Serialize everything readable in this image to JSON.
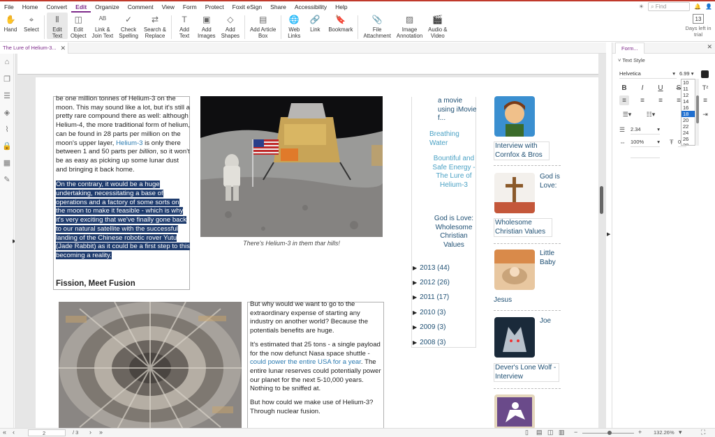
{
  "menu": [
    "File",
    "Home",
    "Convert",
    "Edit",
    "Organize",
    "Comment",
    "View",
    "Form",
    "Protect",
    "Foxit eSign",
    "Share",
    "Accessibility",
    "Help"
  ],
  "menu_active": "Edit",
  "find_placeholder": "Find",
  "ribbon": [
    {
      "label": "Hand",
      "icon": "hand-icon"
    },
    {
      "label": "Select",
      "icon": "select-cursor-icon"
    },
    {
      "label": "Edit\nText",
      "icon": "edit-text-icon",
      "selected": true
    },
    {
      "label": "Edit\nObject",
      "icon": "edit-object-icon"
    },
    {
      "label": "Link &\nJoin Text",
      "icon": "link-join-text-icon"
    },
    {
      "label": "Check\nSpelling",
      "icon": "check-spelling-icon"
    },
    {
      "label": "Search &\nReplace",
      "icon": "search-replace-icon"
    },
    {
      "label": "Add\nText",
      "icon": "add-text-icon"
    },
    {
      "label": "Add\nImages",
      "icon": "add-images-icon"
    },
    {
      "label": "Add\nShapes",
      "icon": "add-shapes-icon"
    },
    {
      "label": "Add Article\nBox",
      "icon": "article-box-icon"
    },
    {
      "label": "Web\nLinks",
      "icon": "web-links-icon"
    },
    {
      "label": "Link",
      "icon": "link-icon"
    },
    {
      "label": "Bookmark",
      "icon": "bookmark-icon"
    },
    {
      "label": "File\nAttachment",
      "icon": "file-attachment-icon"
    },
    {
      "label": "Image\nAnnotation",
      "icon": "image-annotation-icon"
    },
    {
      "label": "Audio &\nVideo",
      "icon": "audio-video-icon"
    }
  ],
  "trial": {
    "days": "13",
    "label": "Days left in trial"
  },
  "doc_tab": "The Lure of Helium-3...",
  "article": {
    "p1_a": "be one million tonnes of Helium-3 on the moon. This may sound like a lot, but it's still a pretty rare compound there as well: although Helium-4, the more traditional form of helium, can be found in 28 parts per million on the moon's upper layer, ",
    "p1_link": "Helium-3",
    "p1_b": " is only there between 1 and 50 parts per ",
    "p1_em": "billion",
    "p1_c": ", so it won't be as easy as picking up some lunar dust and bringing it back home.",
    "p2": "On the contrary, it would be a huge undertaking, necessitating a base of operations and a factory of some sorts on the moon to make it feasible - which is why it's very exciting that we've finally gone back to our natural satellite with the successful landing of the Chinese robotic rover Yutu (Jade Rabbit) as it could be a first step to this becoming a reality.",
    "heading": "Fission, Meet Fusion",
    "caption": "There's Helium-3 in them thar hills!",
    "c3_p1": "But why would we want to go to the extraordinary expense of starting any industry on another world? Because the potentials benefits are huge.",
    "c3_p2_a": "It's estimated that 25 tons - a single payload for the now defunct Nasa space shuttle - ",
    "c3_p2_link": "could power the entire USA for a year",
    "c3_p2_b": ". The entire lunar reserves could potentially power our planet for the next 5-10,000 years. Nothing to be sniffed at.",
    "c3_p3": "But how could we make use of Helium-3? Through nuclear fusion."
  },
  "blog_list": {
    "item1": "a movie using iMovie f...",
    "item2": "Breathing Water",
    "item3": "Bountiful and Safe Energy - The Lure of Helium-3",
    "item4": "God is Love: Wholesome Christian Values",
    "years": [
      "2013 (44)",
      "2012 (26)",
      "2011 (17)",
      "2010 (3)",
      "2009 (3)",
      "2008 (3)"
    ]
  },
  "posts": [
    {
      "title": "Interview with Cornfox & Bros"
    },
    {
      "side": "God is Love:",
      "title": "Wholesome Christian Values"
    },
    {
      "side": "Little Baby",
      "title": "Jesus"
    },
    {
      "side": "Joe",
      "title": "Dever's Lone Wolf - Interview"
    }
  ],
  "panel": {
    "tab": "Form...",
    "section": "Text Style",
    "font": "Helvetica",
    "size": "6.99",
    "sizes": [
      "10",
      "11",
      "12",
      "14",
      "16",
      "18",
      "20",
      "22",
      "24",
      "26",
      "28"
    ],
    "selected_size": "18",
    "line_spacing": "2.34",
    "scale": "100%",
    "char_spacing": "0",
    "color": "#222222"
  },
  "status": {
    "page": "2",
    "total": "/ 3",
    "zoom": "132.26%"
  }
}
